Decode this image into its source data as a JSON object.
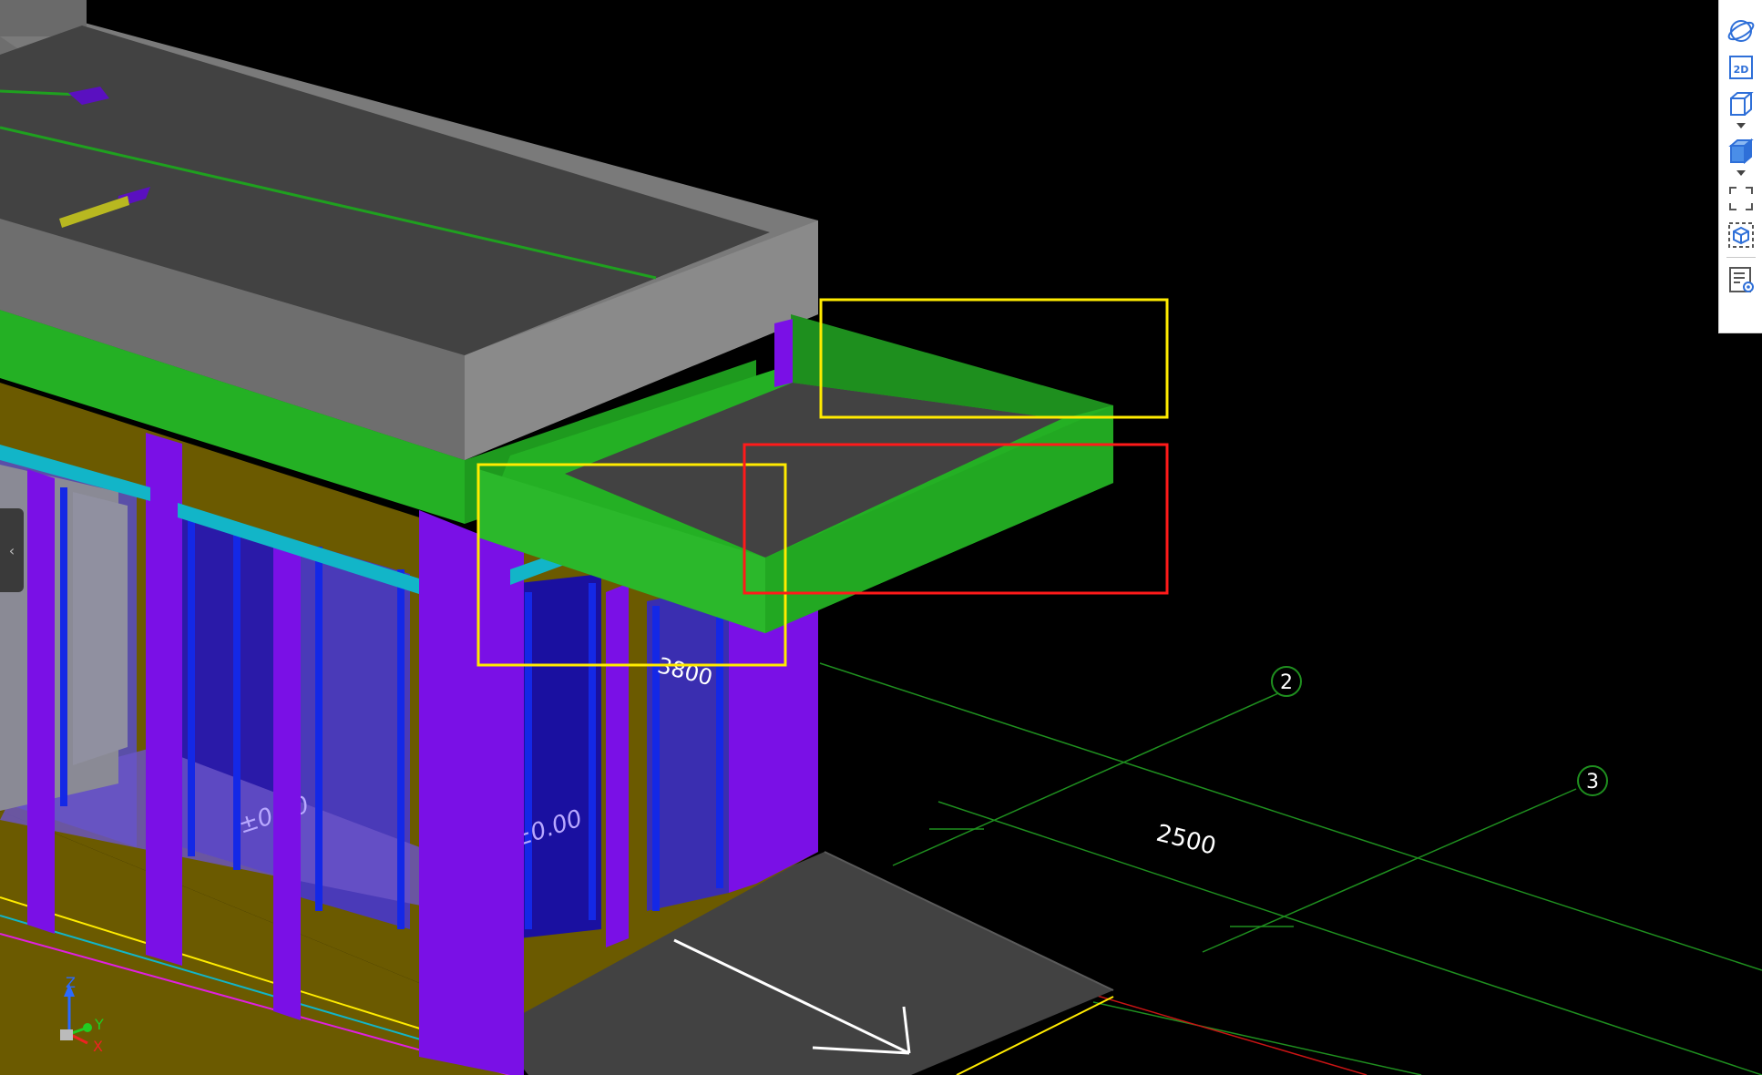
{
  "viewport": {
    "background": "#000000"
  },
  "dimensions": {
    "main_span": "2500",
    "partial_span": "3800",
    "elevation_left": "±0.00",
    "elevation_mid": "±0.00"
  },
  "grid_axes": [
    {
      "label": "2"
    },
    {
      "label": "3"
    }
  ],
  "ucs": {
    "x_label": "X",
    "y_label": "Y",
    "z_label": "Z"
  },
  "toolbar": {
    "items": [
      {
        "icon": "orbit-icon"
      },
      {
        "icon": "2d-view-icon",
        "text": "2D"
      },
      {
        "icon": "wireframe-box-icon"
      },
      {
        "icon": "shaded-box-icon"
      },
      {
        "icon": "zoom-extents-icon"
      },
      {
        "icon": "section-box-icon"
      },
      {
        "icon": "properties-panel-icon"
      }
    ]
  },
  "colors": {
    "green_component": "#24b024",
    "purple_column": "#7a10e6",
    "olive_wall": "#6b5a00",
    "gray_parapet": "#7a7a7a",
    "dark_slab": "#424242",
    "cyan_beam": "#12b5c8",
    "highlight_yellow": "#ffeb00",
    "highlight_red": "#ff1a1a",
    "grid_green": "#1f8f1f"
  }
}
